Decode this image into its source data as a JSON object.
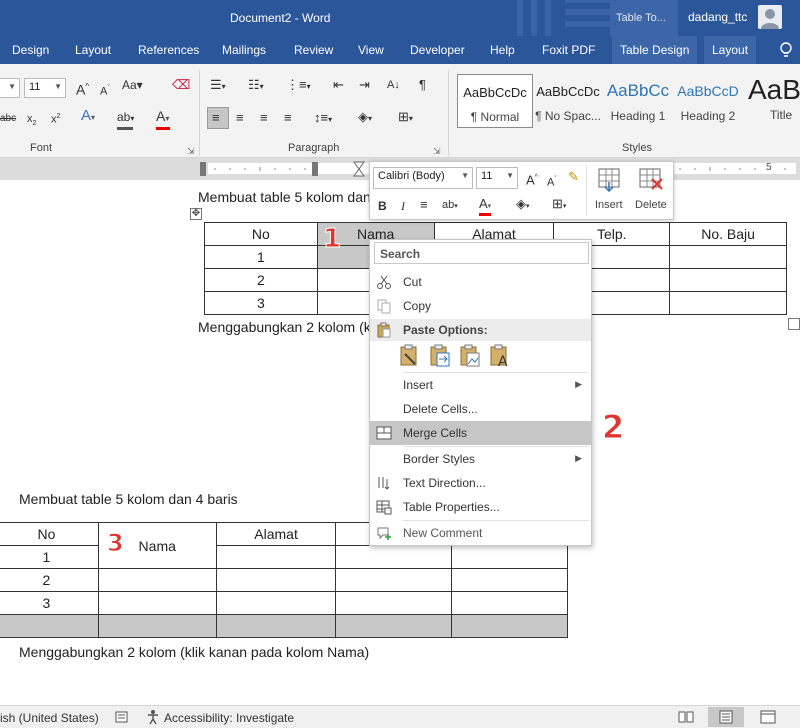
{
  "titlebar": {
    "document": "Document2  -  Word",
    "context_tab": "Table To...",
    "user": "dadang_ttc"
  },
  "menu": {
    "tabs": [
      "Design",
      "Layout",
      "References",
      "Mailings",
      "Review",
      "View",
      "Developer",
      "Help",
      "Foxit PDF",
      "Table Design",
      "Layout"
    ],
    "active_context_tab": "Table Design"
  },
  "ribbon": {
    "font": {
      "size": "11",
      "group_label": "Font"
    },
    "paragraph": {
      "group_label": "Paragraph"
    },
    "styles": {
      "group_label": "Styles",
      "items": [
        {
          "preview": "AaBbCcDc",
          "name": "¶ Normal"
        },
        {
          "preview": "AaBbCcDc",
          "name": "¶ No Spac..."
        },
        {
          "preview": "AaBbCc",
          "name": "Heading 1"
        },
        {
          "preview": "AaBbCcD",
          "name": "Heading 2"
        },
        {
          "preview": "AaB",
          "name": "Title"
        }
      ]
    }
  },
  "mini_toolbar": {
    "font_name": "Calibri (Body)",
    "font_size": "11",
    "insert_label": "Insert",
    "delete_label": "Delete"
  },
  "context_menu": {
    "search_placeholder": "Search",
    "cut": "Cut",
    "copy": "Copy",
    "paste_options": "Paste Options:",
    "insert": "Insert",
    "delete_cells": "Delete Cells...",
    "merge_cells": "Merge Cells",
    "border_styles": "Border Styles",
    "text_direction": "Text Direction...",
    "table_properties": "Table Properties...",
    "new_comment": "New Comment"
  },
  "document": {
    "heading1": "Membuat table 5 kolom dan 4 baris",
    "table1": {
      "headers": [
        "No",
        "Nama",
        "Alamat",
        "Telp.",
        "No. Baju"
      ],
      "rows": [
        [
          "1",
          "",
          "",
          "",
          ""
        ],
        [
          "2",
          "",
          "",
          "",
          ""
        ],
        [
          "3",
          "",
          "",
          "",
          ""
        ]
      ]
    },
    "caption1": "Menggabungkan 2 kolom (klik kanan pada kolom Nama)",
    "heading2": "Membuat table 5 kolom dan 4 baris",
    "table2": {
      "headers": [
        "No",
        "Nama",
        "Alamat",
        "",
        ""
      ],
      "rows": [
        [
          "1",
          "",
          "",
          ""
        ],
        [
          "2",
          "",
          "",
          "",
          ""
        ],
        [
          "3",
          "",
          "",
          "",
          ""
        ],
        [
          "",
          "",
          "",
          "",
          ""
        ]
      ]
    },
    "caption2": "Menggabungkan 2 kolom (klik kanan pada kolom Nama)"
  },
  "annotations": {
    "step1": "1",
    "step2": "2",
    "step3": "3"
  },
  "status": {
    "language": "ish (United States)",
    "accessibility": "Accessibility: Investigate"
  }
}
